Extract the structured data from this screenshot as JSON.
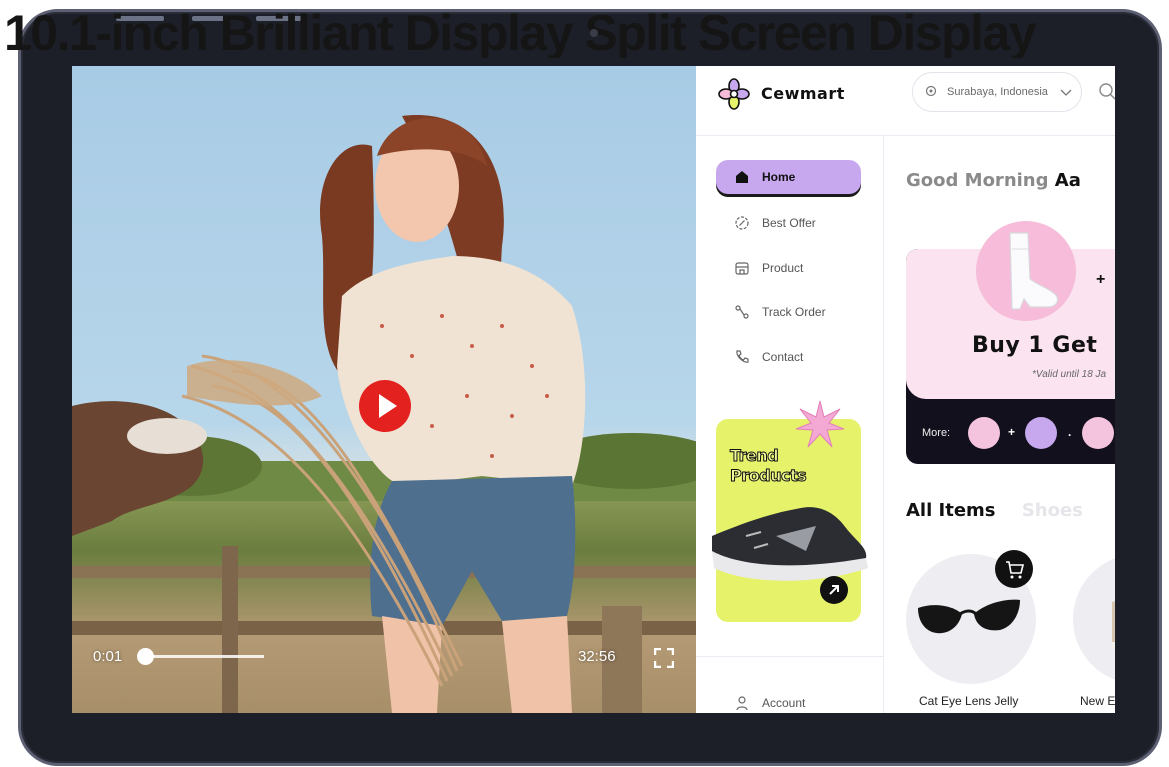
{
  "promo_heading": "10.1-inch Brilliant Display Split Screen Display",
  "video": {
    "current_time": "0:01",
    "duration": "32:56",
    "progress": 0.05
  },
  "app": {
    "brand": "Cewmart",
    "location": "Surabaya, Indonesia",
    "nav": [
      {
        "label": "Home",
        "icon": "home-icon"
      },
      {
        "label": "Best Offer",
        "icon": "badge-icon"
      },
      {
        "label": "Product",
        "icon": "store-icon"
      },
      {
        "label": "Track Order",
        "icon": "route-icon"
      },
      {
        "label": "Contact",
        "icon": "phone-icon"
      }
    ],
    "trend": {
      "line1": "Trend",
      "line2": "Products"
    },
    "account": "Account",
    "greeting_a": "Good Morning",
    "greeting_b": "Aa",
    "promo": {
      "plus": "+",
      "headline": "Buy 1 Get",
      "valid": "*Valid until 18 Ja",
      "more_label": "More:",
      "op1": "+",
      "op2": "."
    },
    "tabs": [
      "All Items",
      "Shoes"
    ],
    "products": [
      "Cat Eye Lens Jelly",
      "New E"
    ]
  },
  "colors": {
    "accent_purple": "#c7a8ee",
    "trend_yellow": "#e5f26a",
    "promo_pink": "#fbe3f0",
    "play_red": "#e3211f"
  }
}
